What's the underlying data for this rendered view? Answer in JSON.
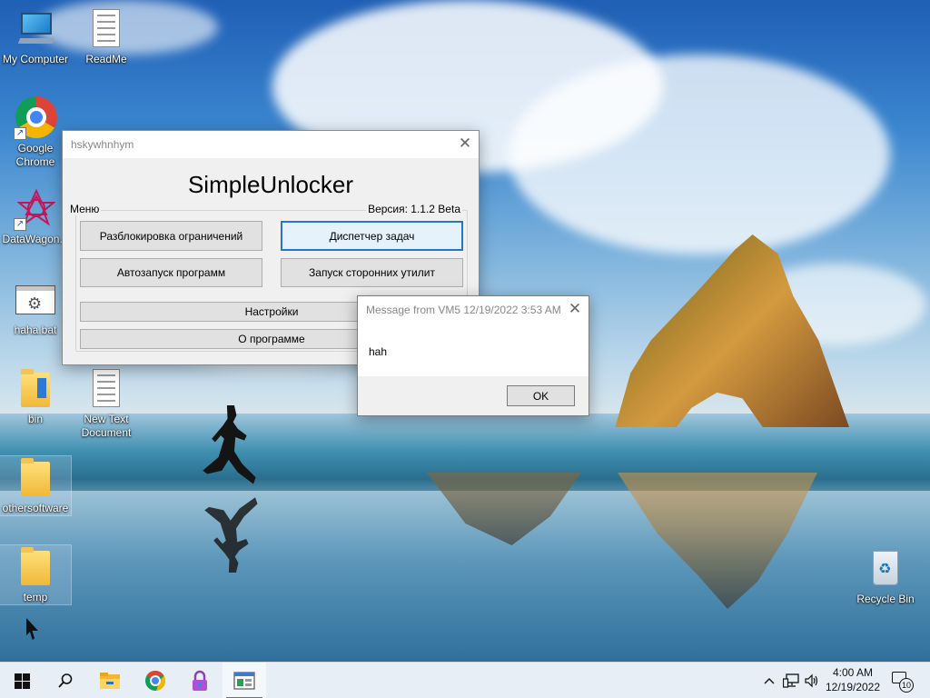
{
  "desktop": {
    "icons": [
      {
        "id": "my-computer",
        "label": "My Computer"
      },
      {
        "id": "readme",
        "label": "ReadMe"
      },
      {
        "id": "google-chrome",
        "label": "Google Chrome"
      },
      {
        "id": "datawagon",
        "label": "DataWagon..."
      },
      {
        "id": "haha-bat",
        "label": "haha.bat"
      },
      {
        "id": "bin",
        "label": "bin"
      },
      {
        "id": "new-text-document",
        "label": "New Text Document"
      },
      {
        "id": "othersoftware",
        "label": "othersoftware"
      },
      {
        "id": "temp",
        "label": "temp"
      },
      {
        "id": "recycle-bin",
        "label": "Recycle Bin"
      }
    ]
  },
  "simple_unlocker": {
    "window_title": "hskywhnhym",
    "heading": "SimpleUnlocker",
    "menu_label": "Меню",
    "version": "Версия: 1.1.2 Beta",
    "buttons": {
      "unlock_restrictions": "Разблокировка ограничений",
      "task_manager": "Диспетчер задач",
      "autorun": "Автозапуск программ",
      "third_party": "Запуск сторонних утилит",
      "settings": "Настройки",
      "about": "О программе"
    },
    "close_glyph": "✕"
  },
  "message_box": {
    "title": "Message from VM5 12/19/2022 3:53 AM",
    "text": "hah",
    "ok_label": "OK",
    "close_glyph": "✕"
  },
  "taskbar": {
    "time": "4:00 AM",
    "date": "12/19/2022",
    "notification_count": "10",
    "apps": [
      "start-icon",
      "search-icon",
      "file-explorer-icon",
      "chrome-icon",
      "lock-app-icon",
      "simple-unlocker-taskbar-icon"
    ],
    "tray": [
      "chevron-up-icon",
      "network-icon",
      "volume-icon",
      "notification-icon"
    ]
  },
  "colors": {
    "accent": "#2377c7",
    "taskbar_bg": "#e7eef5",
    "button_bg": "#e1e1e1"
  }
}
